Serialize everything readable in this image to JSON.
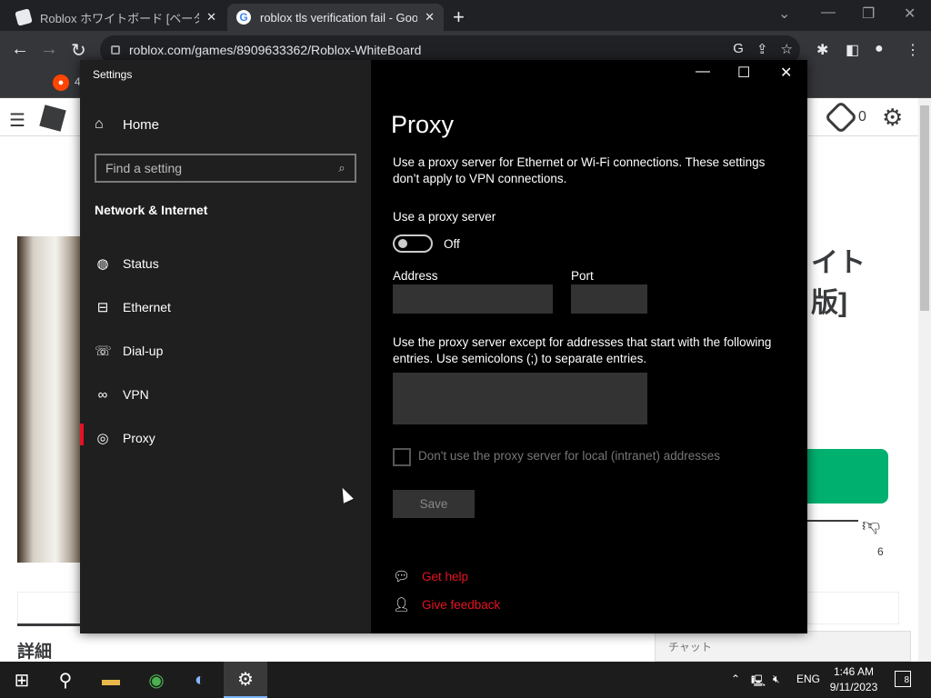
{
  "browser": {
    "tabs": [
      {
        "title": "Roblox ホワイトボード [ベータ版] - Ro"
      },
      {
        "title": "roblox tls verification fail - Googl"
      }
    ],
    "url": "roblox.com/games/8909633362/Roblox-WhiteBoard",
    "bookmark_count": "4"
  },
  "roblox_page": {
    "robux": "0",
    "title_lines": [
      "イト",
      "版]"
    ],
    "dislike_count": "6",
    "details_heading": "詳細",
    "chat_label": "チャット"
  },
  "settings": {
    "window_title": "Settings",
    "home_label": "Home",
    "search_placeholder": "Find a setting",
    "section_title": "Network & Internet",
    "nav": [
      {
        "label": "Status",
        "icon": "globe-status-icon"
      },
      {
        "label": "Ethernet",
        "icon": "ethernet-icon"
      },
      {
        "label": "Dial-up",
        "icon": "dialup-icon"
      },
      {
        "label": "VPN",
        "icon": "vpn-icon"
      },
      {
        "label": "Proxy",
        "icon": "globe-icon",
        "active": true
      }
    ],
    "page_title": "Proxy",
    "description": "Use a proxy server for Ethernet or Wi-Fi connections. These settings don’t apply to VPN connections.",
    "use_proxy_label": "Use a proxy server",
    "toggle_state": "Off",
    "address_label": "Address",
    "address_value": "",
    "port_label": "Port",
    "port_value": "",
    "exceptions_text": "Use the proxy server except for addresses that start with the following entries. Use semicolons (;) to separate entries.",
    "exceptions_value": "",
    "local_checkbox_label": "Don't use the proxy server for local (intranet) addresses",
    "save_label": "Save",
    "get_help": "Get help",
    "give_feedback": "Give feedback",
    "accent_color": "#e81123"
  },
  "taskbar": {
    "language": "ENG",
    "time": "1:46 AM",
    "date": "9/11/2023",
    "notifications": "8"
  }
}
